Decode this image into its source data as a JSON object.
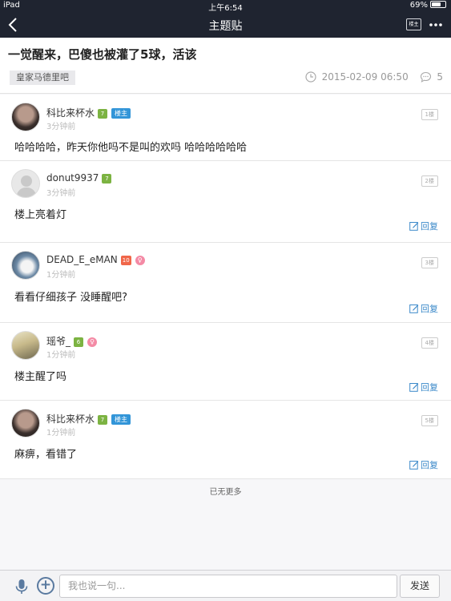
{
  "status_bar": {
    "device": "iPad",
    "time": "上午6:54",
    "battery": "69%",
    "battery_fraction": 0.69
  },
  "nav": {
    "title": "主题贴",
    "op_only_label": "楼主"
  },
  "thread": {
    "title": "一觉醒来，巴傻也被灌了5球，活该",
    "forum": "皇家马德里吧",
    "datetime": "2015-02-09 06:50",
    "comment_count": "5"
  },
  "posts": [
    {
      "user": "科比来杯水",
      "level": "7",
      "level_color": "#7cb342",
      "female": false,
      "op": true,
      "op_label": "楼主",
      "time": "3分钟前",
      "floor": "1楼",
      "content": "哈哈哈哈，昨天你他吗不是叫的欢吗 哈哈哈哈哈哈",
      "reply": ""
    },
    {
      "user": "donut9937",
      "level": "7",
      "level_color": "#7cb342",
      "female": false,
      "op": false,
      "time": "3分钟前",
      "floor": "2楼",
      "content": "楼上亮着灯",
      "reply": "回复"
    },
    {
      "user": "DEAD_E_eMAN",
      "level": "10",
      "level_color": "#f0674a",
      "female": true,
      "op": false,
      "time": "1分钟前",
      "floor": "3楼",
      "content": "看看仔细孩子 没睡醒吧?",
      "reply": "回复"
    },
    {
      "user": "瑶爷_",
      "level": "6",
      "level_color": "#7cb342",
      "female": true,
      "op": false,
      "time": "1分钟前",
      "floor": "4楼",
      "content": "楼主醒了吗",
      "reply": "回复"
    },
    {
      "user": "科比来杯水",
      "level": "7",
      "level_color": "#7cb342",
      "female": false,
      "op": true,
      "op_label": "楼主",
      "time": "1分钟前",
      "floor": "5楼",
      "content": "麻痹，看错了",
      "reply": "回复"
    }
  ],
  "no_more_text": "已无更多",
  "composer": {
    "placeholder": "我也说一句...",
    "send_label": "发送"
  },
  "icons": {
    "back": "chevron-left-icon",
    "more": "ellipsis-icon",
    "clock": "clock-icon",
    "comment": "comment-bubble-icon",
    "mic": "microphone-icon",
    "plus": "plus-icon",
    "reply": "edit-reply-icon"
  },
  "colors": {
    "nav_bg": "#1f2430",
    "link_blue": "#3a88c9",
    "op_badge": "#3295d8"
  }
}
